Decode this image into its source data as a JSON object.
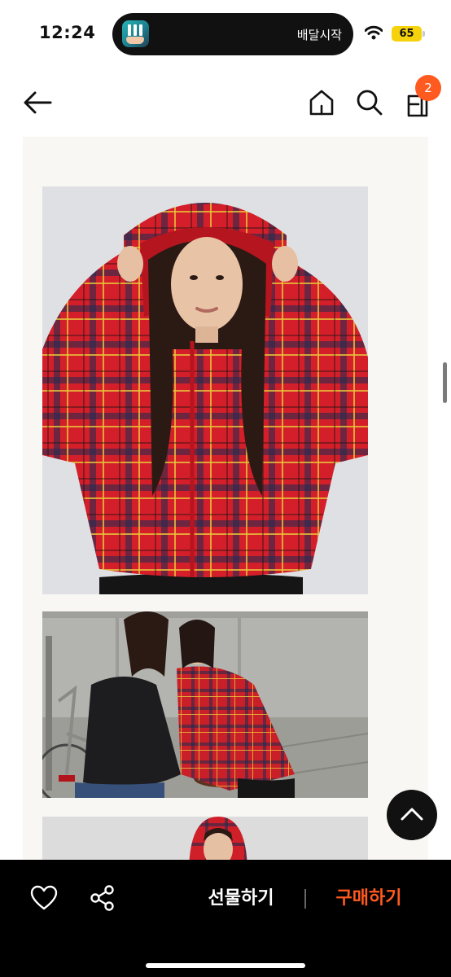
{
  "status_bar": {
    "time": "12:24",
    "island_text": "배달시작",
    "battery": "65"
  },
  "header": {
    "cart_count": "2"
  },
  "icons": {
    "back": "arrow-left-icon",
    "home": "home-icon",
    "search": "search-icon",
    "shop": "shop-bag-icon",
    "scroll_top": "chevron-up-icon",
    "like": "heart-icon",
    "share": "share-icon"
  },
  "product_images": [
    {
      "description": "model in red tartan hooded zip jacket, studio background"
    },
    {
      "description": "two models leaning on bicycle, black and red tartan jackets, outdoor wall"
    },
    {
      "description": "model in red tartan hood, cropped"
    }
  ],
  "bottom_bar": {
    "gift_label": "선물하기",
    "buy_label": "구매하기"
  },
  "colors": {
    "accent": "#ff5a1f",
    "bottom_bar_bg": "#000000",
    "battery": "#f5d20b"
  }
}
